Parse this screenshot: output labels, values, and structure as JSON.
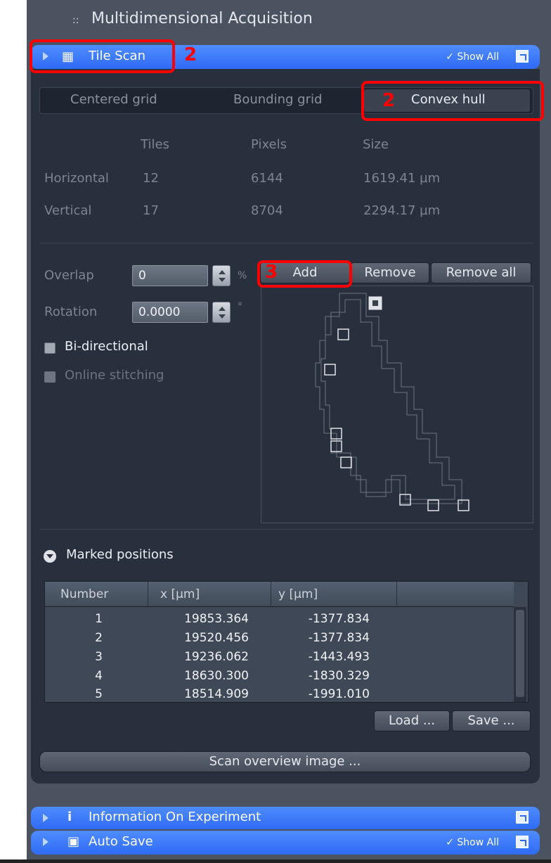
{
  "panel": {
    "title": "Multidimensional Acquisition",
    "grip": "::"
  },
  "tile_scan": {
    "label": "Tile Scan",
    "show_all": "✓ Show All"
  },
  "tabs": [
    "Centered grid",
    "Bounding grid",
    "Convex hull"
  ],
  "table_headers": [
    "Tiles",
    "Pixels",
    "Size"
  ],
  "rows": [
    {
      "label": "Horizontal",
      "tiles": "12",
      "pixels": "6144",
      "size": "1619.41 µm"
    },
    {
      "label": "Vertical",
      "tiles": "17",
      "pixels": "8704",
      "size": "2294.17 µm"
    }
  ],
  "overlap": {
    "label": "Overlap",
    "value": "0",
    "unit": "%"
  },
  "rotation": {
    "label": "Rotation",
    "value": "0.0000",
    "unit": "°"
  },
  "options": {
    "bidirectional": "Bi-directional",
    "online_stitching": "Online stitching"
  },
  "buttons": {
    "add": "Add",
    "remove": "Remove",
    "remove_all": "Remove all",
    "load": "Load ...",
    "save": "Save ...",
    "scan_overview": "Scan overview image ..."
  },
  "marked_positions": {
    "title": "Marked positions",
    "columns": [
      "Number",
      "x [µm]",
      "y [µm]",
      ""
    ],
    "rows": [
      {
        "n": "1",
        "x": "19853.364",
        "y": "-1377.834"
      },
      {
        "n": "2",
        "x": "19520.456",
        "y": "-1377.834"
      },
      {
        "n": "3",
        "x": "19236.062",
        "y": "-1443.493"
      },
      {
        "n": "4",
        "x": "18630.300",
        "y": "-1830.329"
      },
      {
        "n": "5",
        "x": "18514.909",
        "y": "-1991.010"
      }
    ]
  },
  "sections": {
    "info": "Information On Experiment",
    "autosave": "Auto Save",
    "autosave_show_all": "✓ Show All"
  },
  "annotations": {
    "tile_num": "2",
    "hull_num": "2",
    "add_num": "3"
  },
  "colors": {
    "accent_blue": "#2f6bf4",
    "highlight_red": "#ff0000"
  }
}
